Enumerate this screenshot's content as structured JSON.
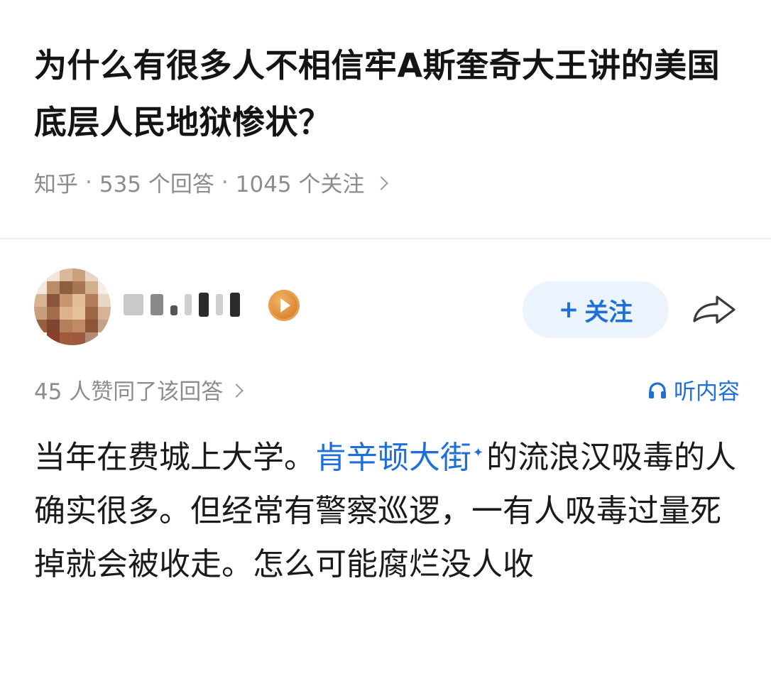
{
  "question": {
    "title": "为什么有很多人不相信牢A斯奎奇大王讲的美国底层人民地狱惨状？",
    "source": "知乎",
    "answers": "535 个回答",
    "follows": "1045 个关注",
    "separator": "·"
  },
  "author": {
    "avatar_icon": "avatar-pixelated",
    "badge_icon": "orange-play-badge-icon",
    "follow_plus": "+",
    "follow_label": "关注",
    "share_icon": "share-arrow-icon"
  },
  "meta": {
    "votes": "45 人赞同了该回答",
    "listen_icon": "headphones-icon",
    "listen_label": "听内容"
  },
  "answer": {
    "before_link": "当年在费城上大学。",
    "link": "肯辛顿大街",
    "link_mark": "✦",
    "after_link": "的流浪汉吸毒的人确实很多。但经常有警察巡逻，一有人吸毒过量死掉就会被收走。怎么可能腐烂没人收"
  },
  "colors": {
    "accent": "#1e6fd9",
    "follow_bg": "#ebf3fd",
    "muted": "#8c8c8c",
    "badge": "#e09a4a"
  }
}
